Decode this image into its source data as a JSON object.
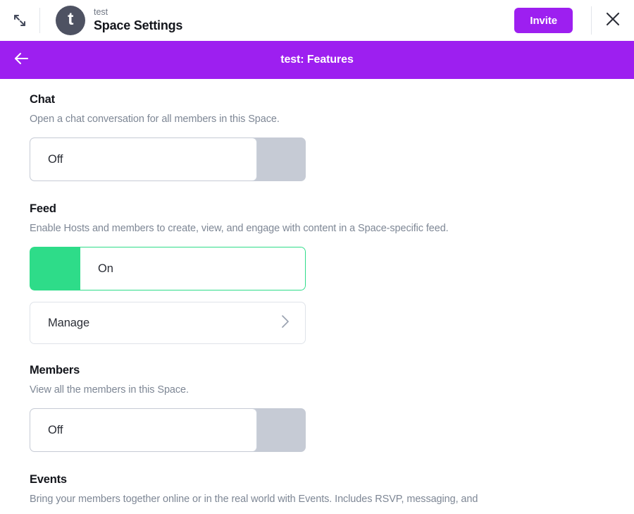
{
  "topbar": {
    "expand_icon": "expand-diagonal-icon",
    "avatar_letter": "t",
    "space_name": "test",
    "title": "Space Settings",
    "invite_label": "Invite",
    "close_icon": "close-icon"
  },
  "subheader": {
    "back_icon": "arrow-left-icon",
    "title": "test: Features"
  },
  "colors": {
    "purple": "#9d1ff0",
    "green": "#2edc89",
    "toggle_off_gray": "#c6cbd5",
    "heading": "#14161c",
    "description": "#7e8795",
    "avatar_bg": "#4e5262"
  },
  "sections": [
    {
      "title": "Chat",
      "description": "Open a chat conversation for all members in this Space.",
      "toggle_state": "Off"
    },
    {
      "title": "Feed",
      "description": "Enable Hosts and members to create, view, and engage with content in a Space-specific feed.",
      "toggle_state": "On",
      "manage_label": "Manage",
      "manage_chevron": "chevron-right-icon"
    },
    {
      "title": "Members",
      "description": "View all the members in this Space.",
      "toggle_state": "Off"
    },
    {
      "title": "Events",
      "description": "Bring your members together online or in the real world with Events. Includes RSVP, messaging, and"
    }
  ]
}
